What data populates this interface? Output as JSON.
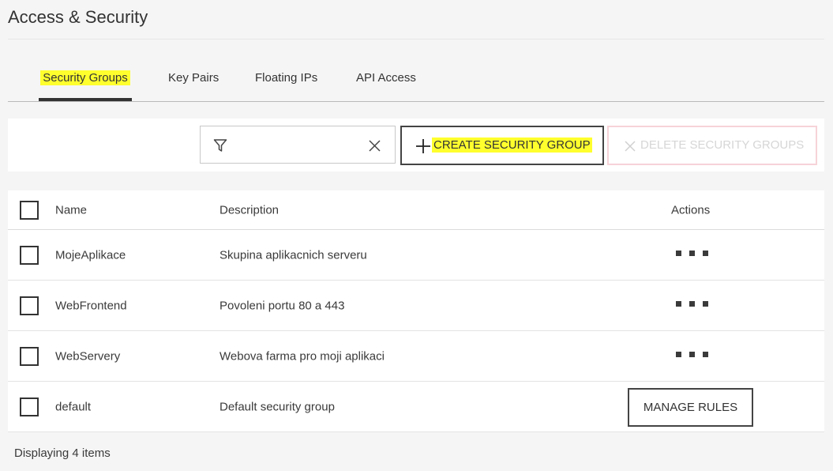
{
  "page": {
    "title": "Access & Security"
  },
  "tabs": [
    {
      "label": "Security Groups",
      "active": true
    },
    {
      "label": "Key Pairs",
      "active": false
    },
    {
      "label": "Floating IPs",
      "active": false
    },
    {
      "label": "API Access",
      "active": false
    }
  ],
  "toolbar": {
    "filter_value": "",
    "create_label": "CREATE SECURITY GROUP",
    "delete_label": "DELETE SECURITY GROUPS"
  },
  "table": {
    "columns": {
      "name": "Name",
      "description": "Description",
      "actions": "Actions"
    },
    "rows": [
      {
        "name": "MojeAplikace",
        "description": "Skupina aplikacnich serveru",
        "action": "menu"
      },
      {
        "name": "WebFrontend",
        "description": "Povoleni portu 80 a 443",
        "action": "menu"
      },
      {
        "name": "WebServery",
        "description": "Webova farma pro moji aplikaci",
        "action": "menu"
      },
      {
        "name": "default",
        "description": "Default security group",
        "action": "MANAGE RULES"
      }
    ],
    "footer": "Displaying 4 items"
  },
  "colors": {
    "highlight": "#ffff2e",
    "text": "#333333",
    "background": "#f5f5f5",
    "disabled_border": "#f6d3d8"
  },
  "icons": {
    "filter": "filter-icon",
    "clear": "close-icon",
    "create": "plus-icon",
    "delete": "close-icon",
    "row_actions": "more-horizontal-icon"
  }
}
